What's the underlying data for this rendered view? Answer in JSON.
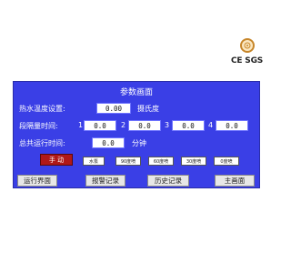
{
  "panel": {
    "title": "参数画面",
    "water_temp": {
      "label": "热水温度设置:",
      "value": "0.00",
      "unit": "摄氏度"
    },
    "segment_time": {
      "label": "段隔量时间:",
      "segments": [
        {
          "index": "1",
          "value": "0.0"
        },
        {
          "index": "2",
          "value": "0.0"
        },
        {
          "index": "3",
          "value": "0.0"
        },
        {
          "index": "4",
          "value": "0.0"
        }
      ]
    },
    "total_time": {
      "label": "总共运行时间:",
      "value": "0.0",
      "unit": "分钟"
    },
    "manual_button": "手  动",
    "mode_buttons": [
      "水泵",
      "90度喷",
      "60度喷",
      "30度喷",
      "0度喷"
    ]
  },
  "nav": [
    "运行界面",
    "报警记录",
    "历史记录",
    "主画面"
  ],
  "cert": {
    "text": "CE SGS",
    "icon": "certification-seal-icon"
  },
  "colors": {
    "panel": "#3a3fe6",
    "manual": "#b01818",
    "nav": "#e7e7e7"
  }
}
